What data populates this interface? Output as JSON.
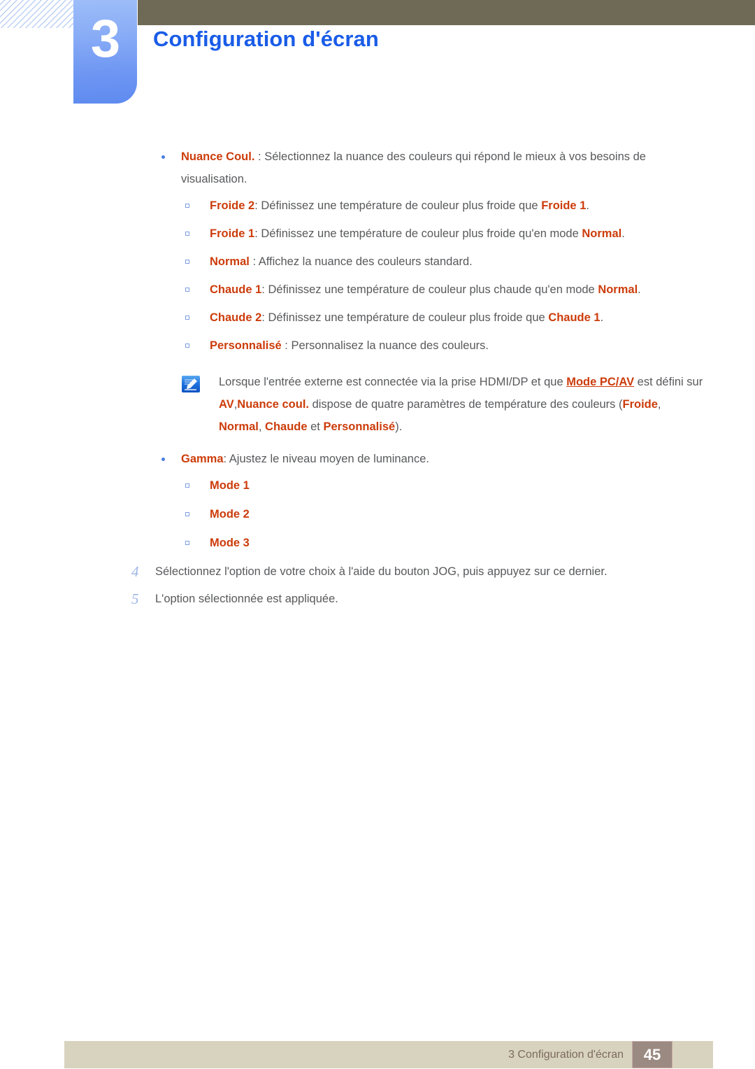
{
  "header": {
    "chapter_number": "3",
    "chapter_title": "Configuration d'écran",
    "bar_color": "#6e6a56",
    "tab_color": "#7ba2f5",
    "title_color": "#1a5ce8"
  },
  "colors": {
    "accent_orange": "#cc3c0b",
    "body_text": "#58595b",
    "step_number": "#9fb6e8",
    "bullet_blue": "#4a7fe0",
    "footer_bg": "#d8d3be",
    "footer_text": "#7c6a60",
    "page_box_bg": "#9b8a81"
  },
  "body": {
    "nuance": {
      "term": "Nuance Coul.",
      "rest": " : Sélectionnez la nuance des couleurs qui répond le mieux à vos besoins de visualisation."
    },
    "options": [
      {
        "term": "Froide 2",
        "mid": ": Définissez une température de couleur plus froide que ",
        "ref": "Froide 1",
        "tail": "."
      },
      {
        "term": "Froide 1",
        "mid": ": Définissez une température de couleur plus froide qu'en mode ",
        "ref": "Normal",
        "tail": "."
      },
      {
        "term": "Normal",
        "mid": " : Affichez la nuance des couleurs standard.",
        "ref": "",
        "tail": ""
      },
      {
        "term": "Chaude 1",
        "mid": ": Définissez une température de couleur plus chaude qu'en mode ",
        "ref": "Normal",
        "tail": "."
      },
      {
        "term": "Chaude 2",
        "mid": ": Définissez une température de couleur plus froide que ",
        "ref": "Chaude 1",
        "tail": "."
      },
      {
        "term": "Personnalisé",
        "mid": " : Personnalisez la nuance des couleurs.",
        "ref": "",
        "tail": ""
      }
    ],
    "note": {
      "icon": "note-pencil-icon",
      "p1": "Lorsque l'entrée externe est connectée via la prise HDMI/DP et que ",
      "link": "Mode PC/AV",
      "p2": " est défini sur ",
      "av": "AV",
      "p3": ",",
      "nuance_coul": "Nuance coul.",
      "p4": " dispose de quatre paramètres de température des couleurs (",
      "t1": "Froide",
      "p5": ", ",
      "t2": "Normal",
      "p6": ", ",
      "t3": "Chaude",
      "p7": " et ",
      "t4": "Personnalisé",
      "p8": ")."
    },
    "gamma": {
      "term": "Gamma",
      "rest": ": Ajustez le niveau moyen de luminance.",
      "modes": [
        "Mode 1",
        "Mode 2",
        "Mode 3"
      ]
    },
    "steps": [
      {
        "num": "4",
        "text": "Sélectionnez l'option de votre choix à l'aide du bouton JOG, puis appuyez sur ce dernier."
      },
      {
        "num": "5",
        "text": "L'option sélectionnée est appliquée."
      }
    ]
  },
  "footer": {
    "text": "3 Configuration d'écran",
    "page_number": "45"
  }
}
